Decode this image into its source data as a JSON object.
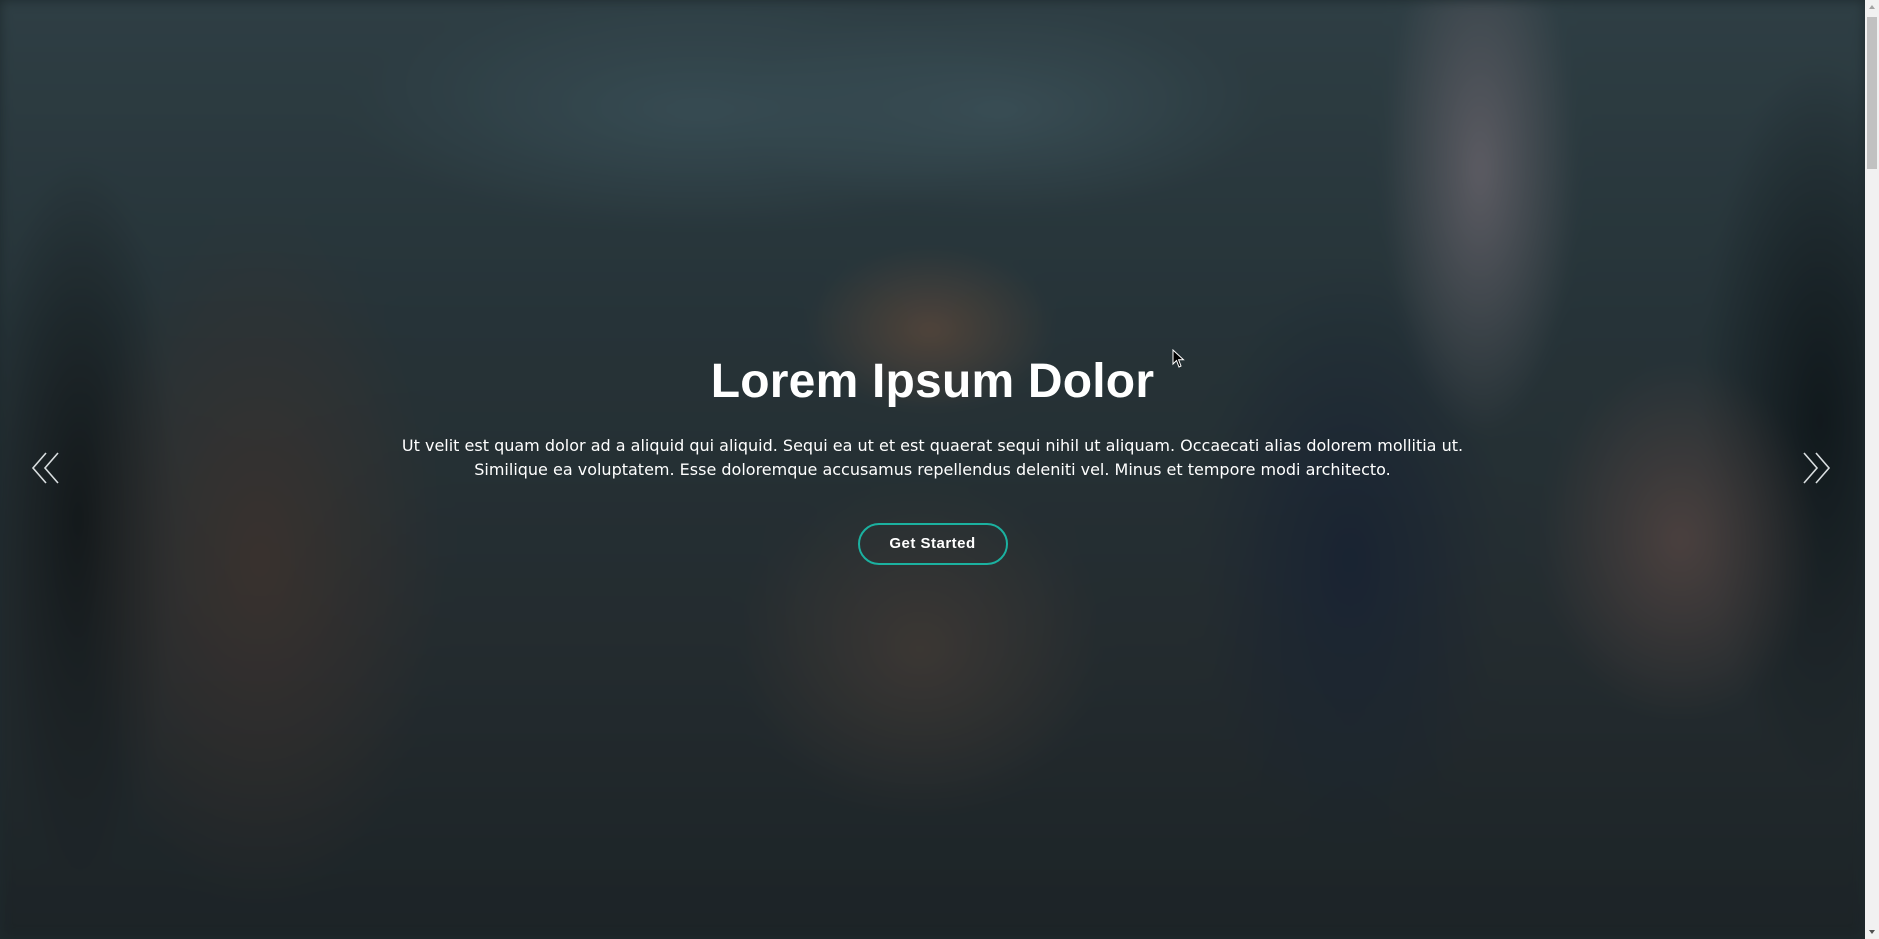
{
  "hero": {
    "title": "Lorem Ipsum Dolor",
    "description": "Ut velit est quam dolor ad a aliquid qui aliquid. Sequi ea ut et est quaerat sequi nihil ut aliquam. Occaecati alias dolorem mollitia ut. Similique ea voluptatem. Esse doloremque accusamus repellendus deleniti vel. Minus et tempore modi architecto.",
    "cta_label": "Get Started",
    "background_image": "team-meeting-photo"
  },
  "carousel": {
    "prev_icon": "double-chevron-left-icon",
    "next_icon": "double-chevron-right-icon"
  },
  "colors": {
    "accent": "#1bb1a0",
    "text": "#ffffff",
    "overlay": "#0c161a"
  }
}
